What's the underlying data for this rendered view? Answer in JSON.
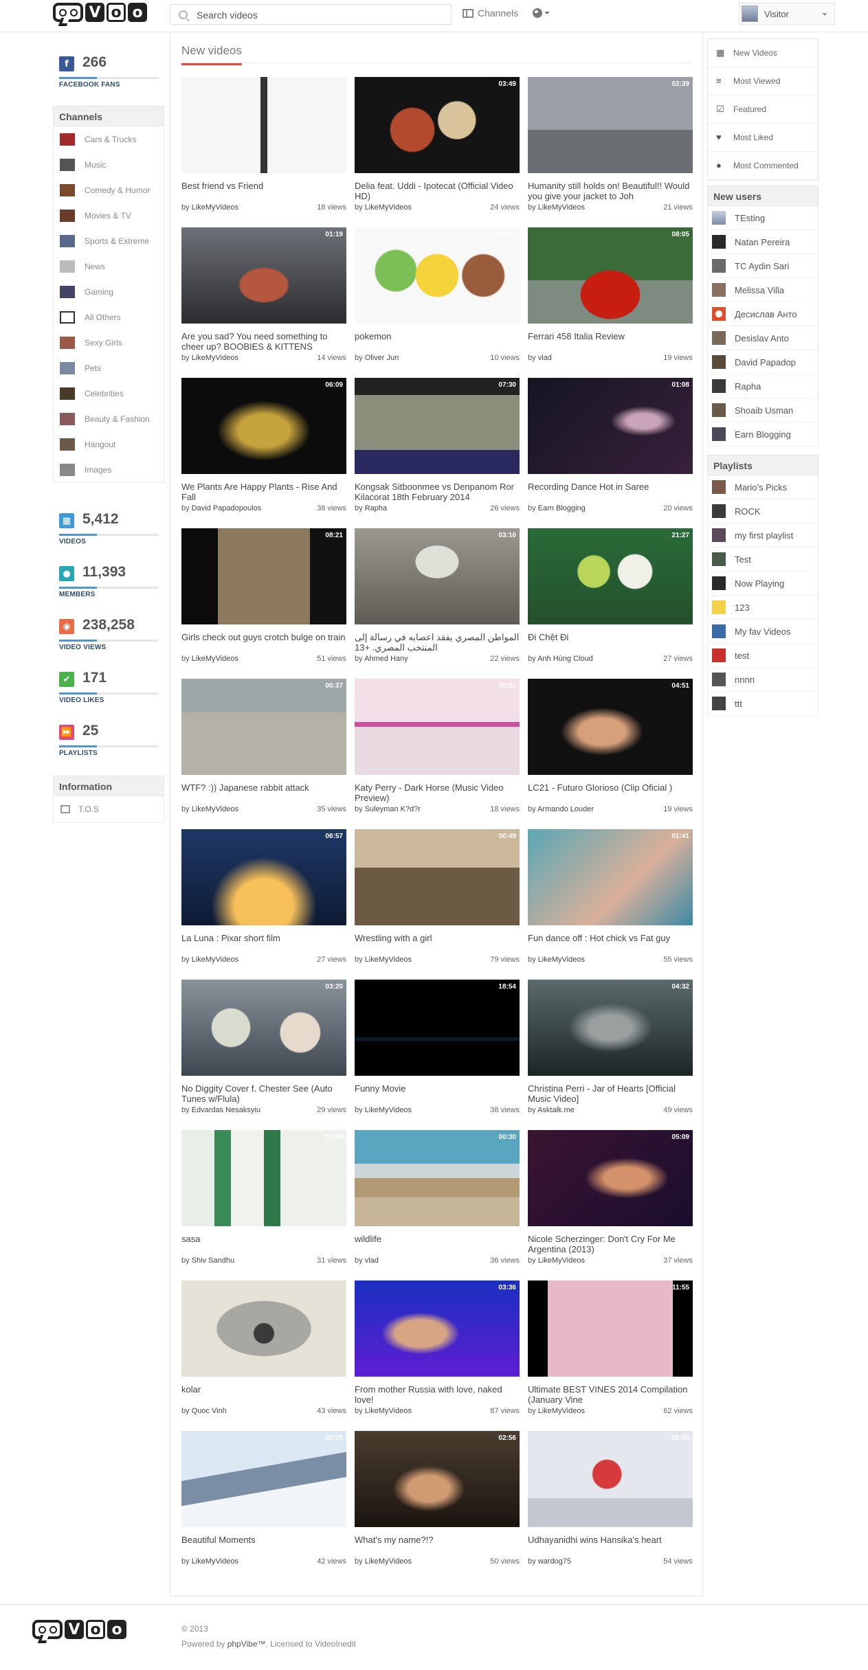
{
  "header": {
    "search_placeholder": "Search videos",
    "channels_label": "Channels",
    "user_name": "Visitor"
  },
  "left": {
    "facebook": {
      "value": "266",
      "label": "FACEBOOK FANS"
    },
    "channels_title": "Channels",
    "channels": [
      "Cars & Trucks",
      "Music",
      "Comedy & Humor",
      "Movies & TV",
      "Sports & Extreme",
      "News",
      "Gaming",
      "All Others",
      "Sexy Girls",
      "Pets",
      "Celebrities",
      "Beauty & Fashion",
      "Hangout",
      "Images"
    ],
    "stats": [
      {
        "value": "5,412",
        "label": "VIDEOS",
        "color": "#3f9ad6",
        "icon": "film-icon"
      },
      {
        "value": "11,393",
        "label": "MEMBERS",
        "color": "#27a7b3",
        "icon": "users-icon"
      },
      {
        "value": "238,258",
        "label": "VIDEO VIEWS",
        "color": "#ec6a45",
        "icon": "eye-icon"
      },
      {
        "value": "171",
        "label": "VIDEO LIKES",
        "color": "#4bb14b",
        "icon": "check-icon"
      },
      {
        "value": "25",
        "label": "PLAYLISTS",
        "color": "#e2477a",
        "icon": "forward-icon"
      }
    ],
    "info_title": "Information",
    "info_items": [
      "T.O.S"
    ]
  },
  "main": {
    "title": "New videos",
    "videos": [
      {
        "title": "Best friend vs Friend",
        "duration": "",
        "author": "LikeMyVideos",
        "views": "18 views",
        "thumb": "comic"
      },
      {
        "title": "Delia feat. Uddi - Ipotecat (Official Video HD)",
        "duration": "03:49",
        "author": "LikeMyVideos",
        "views": "24 views",
        "thumb": "dark"
      },
      {
        "title": "Humanity still holds on! Beautiful!! Would you give your jacket to Joh",
        "duration": "02:39",
        "author": "LikeMyVideos",
        "views": "21 views",
        "thumb": "gray"
      },
      {
        "title": "Are you sad? You need something to cheer up? BOOBIES & KITTENS",
        "duration": "01:19",
        "author": "LikeMyVideos",
        "views": "14 views",
        "thumb": "cat"
      },
      {
        "title": "pokemon",
        "duration": "00:30",
        "author": "Oliver Jun",
        "views": "10 views",
        "thumb": "pokemon"
      },
      {
        "title": "Ferrari 458 Italia Review",
        "duration": "08:05",
        "author": "vlad",
        "views": "19 views",
        "thumb": "ferrari"
      },
      {
        "title": "We Plants Are Happy Plants - Rise And Fall",
        "duration": "06:09",
        "author": "David Papadopoulos",
        "views": "38 views",
        "thumb": "gold"
      },
      {
        "title": "Kongsak Sitboonmee vs Denpanom Ror Kilacorat 18th February 2014",
        "duration": "07:30",
        "author": "Rapha",
        "views": "26 views",
        "thumb": "ring"
      },
      {
        "title": "Recording Dance Hot in Saree",
        "duration": "01:08",
        "author": "Earn Blogging",
        "views": "20 views",
        "thumb": "stage"
      },
      {
        "title": "Girls check out guys crotch bulge on train",
        "duration": "08:21",
        "author": "LikeMyVideos",
        "views": "51 views",
        "thumb": "train"
      },
      {
        "title": "المواطن المصري يفقد اعصابه في رسالة إلى المنتخب المصري. +13",
        "duration": "03:10",
        "author": "Ahmed Hany",
        "views": "22 views",
        "thumb": "alien"
      },
      {
        "title": "Đi Chệt Đi",
        "duration": "21:27",
        "author": "Anh Hùng Cloud",
        "views": "27 views",
        "thumb": "comedy"
      },
      {
        "title": "WTF? :)) Japanese rabbit attack",
        "duration": "00:37",
        "author": "LikeMyVideos",
        "views": "35 views",
        "thumb": "rabbits"
      },
      {
        "title": "Katy Perry - Dark Horse (Music Video Preview)",
        "duration": "00:33",
        "author": "Suleyman K?d?r",
        "views": "18 views",
        "thumb": "darkhorse"
      },
      {
        "title": "LC21 - Futuro Glorioso (Clip Oficial )",
        "duration": "04:51",
        "author": "Armando Louder",
        "views": "19 views",
        "thumb": "singer"
      },
      {
        "title": "La Luna : Pixar short film",
        "duration": "06:57",
        "author": "LikeMyVideos",
        "views": "27 views",
        "thumb": "luna"
      },
      {
        "title": "Wrestling with a girl",
        "duration": "00:49",
        "author": "LikeMyVideos",
        "views": "79 views",
        "thumb": "room"
      },
      {
        "title": "Fun dance off : Hot chick vs Fat guy",
        "duration": "01:41",
        "author": "LikeMyVideos",
        "views": "55 views",
        "thumb": "beach"
      },
      {
        "title": "No Diggity Cover f. Chester See (Auto Tunes w/Flula)",
        "duration": "03:20",
        "author": "Edvardas Nesaksyiu",
        "views": "29 views",
        "thumb": "car"
      },
      {
        "title": "Funny Movie",
        "duration": "18:54",
        "author": "LikeMyVideos",
        "views": "38 views",
        "thumb": "black"
      },
      {
        "title": "Christina Perri - Jar of Hearts [Official Music Video]",
        "duration": "04:32",
        "author": "Asktalk.me",
        "views": "49 views",
        "thumb": "bw"
      },
      {
        "title": "sasa",
        "duration": "01:08",
        "author": "Shiv Sandhu",
        "views": "31 views",
        "thumb": "crowd"
      },
      {
        "title": "wildlife",
        "duration": "00:30",
        "author": "vlad",
        "views": "36 views",
        "thumb": "horses"
      },
      {
        "title": "Nicole Scherzinger: Don't Cry For Me Argentina (2013)",
        "duration": "05:09",
        "author": "LikeMyVideos",
        "views": "37 views",
        "thumb": "nicole"
      },
      {
        "title": "kolar",
        "duration": "",
        "author": "Quoc Vinh",
        "views": "43 views",
        "thumb": "koala"
      },
      {
        "title": "From mother Russia with love, naked love!",
        "duration": "03:36",
        "author": "LikeMyVideos",
        "views": "87 views",
        "thumb": "russia"
      },
      {
        "title": "Ultimate BEST VINES 2014 Compilation (January Vine",
        "duration": "11:55",
        "author": "LikeMyVideos",
        "views": "62 views",
        "thumb": "vines"
      },
      {
        "title": "Beautiful Moments",
        "duration": "03:28",
        "author": "LikeMyVideos",
        "views": "42 views",
        "thumb": "mountain"
      },
      {
        "title": "What's my name?!?",
        "duration": "02:56",
        "author": "LikeMyVideos",
        "views": "50 views",
        "thumb": "party"
      },
      {
        "title": "Udhayanidhi wins Hansika's heart",
        "duration": "09:49",
        "author": "wardog75",
        "views": "54 views",
        "thumb": "hansika"
      }
    ],
    "by_label": "by"
  },
  "right": {
    "menu": [
      {
        "label": "New Videos",
        "icon": "calendar-icon"
      },
      {
        "label": "Most Viewed",
        "icon": "list-icon"
      },
      {
        "label": "Featured",
        "icon": "check-icon"
      },
      {
        "label": "Most Liked",
        "icon": "heart-icon"
      },
      {
        "label": "Most Commented",
        "icon": "comment-icon"
      }
    ],
    "new_users_title": "New users",
    "new_users": [
      "TEsting",
      "Natan Pereira",
      "TC Aydin Sari",
      "Melissa Villa",
      "Десислав Анто",
      "Desislav Anto",
      "David Papadop",
      "Rapha",
      "Shoaib Usman",
      "Earn Blogging"
    ],
    "playlists_title": "Playlists",
    "playlists": [
      "Mario's Picks",
      "ROCK",
      "my first playlist",
      "Test",
      "Now Playing",
      "123",
      "My fav Videos",
      "test",
      "nnnn",
      "ttt"
    ]
  },
  "footer": {
    "copyright": "© 2013",
    "powered_prefix": "Powered by ",
    "powered_brand": "phpVibe™",
    "license": ". Licensed to VideoInedit"
  }
}
